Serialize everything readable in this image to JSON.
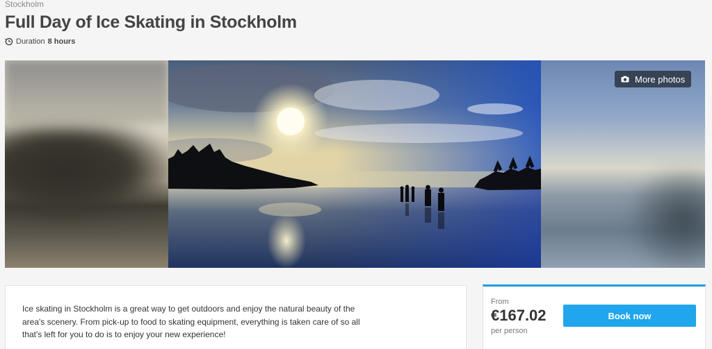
{
  "breadcrumb": "Stockholm",
  "title": "Full Day of Ice Skating in Stockholm",
  "duration": {
    "label": "Duration",
    "value": "8 hours",
    "icon": "clock-icon"
  },
  "gallery": {
    "more_photos_label": "More photos",
    "more_photos_icon": "camera-icon"
  },
  "description": "Ice skating in Stockholm is a great way to get outdoors and enjoy the natural beauty of the area's scenery. From pick-up to food to skating equipment, everything is taken care of so all that's left for you to do is to enjoy your new experience!",
  "booking": {
    "from_label": "From",
    "price": "€167.02",
    "per_label": "per person",
    "button_label": "Book now"
  },
  "colors": {
    "accent": "#1fa6ec",
    "card_top_border": "#1f9be0",
    "title": "#444444"
  }
}
